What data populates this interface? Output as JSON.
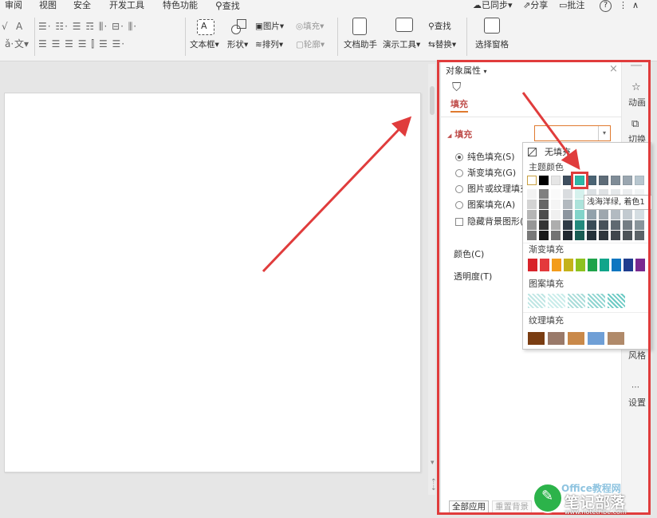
{
  "menu": {
    "review": "审阅",
    "view": "视图",
    "security": "安全",
    "developer": "开发工具",
    "special": "特色功能",
    "search": "查找",
    "synced": "已同步",
    "share": "分享",
    "comment": "批注",
    "help": "?"
  },
  "ribbon": {
    "textbox": "文本框",
    "shape": "形状",
    "picture": "图片",
    "fill": "填充",
    "arrange": "排列",
    "outline": "轮廓",
    "doc_helper": "文档助手",
    "present_tools": "演示工具",
    "find": "查找",
    "replace": "替换",
    "select_pane": "选择窗格",
    "text_a": "A",
    "text_wen": "文"
  },
  "panel": {
    "title": "对象属性",
    "fill_tab": "填充",
    "fill_section": "填充",
    "solid_fill": "纯色填充(S)",
    "gradient_fill": "渐变填充(G)",
    "picture_fill": "图片或纹理填充",
    "pattern_fill": "图案填充(A)",
    "hide_bg": "隐藏背景图形(",
    "color_label": "颜色(C)",
    "transparency_label": "透明度(T)",
    "apply_all": "全部应用",
    "reset_bg": "重置背景"
  },
  "popup": {
    "no_fill": "无填充",
    "theme_colors": "主题颜色",
    "gradient_fill": "渐变填充",
    "pattern_fill": "图案填充",
    "texture_fill": "纹理填充",
    "tooltip": "浅海洋绿, 着色1",
    "theme_row": [
      "#ffffff",
      "#000000",
      "#e6e6e6",
      "#3f4f5f",
      "#2fb8a6",
      "#4a6474",
      "#5e6c78",
      "#7f8c97",
      "#9aa6b0",
      "#b7c6cf"
    ],
    "gradient_colors": [
      "#d8232a",
      "#e4393c",
      "#f39c1b",
      "#c4b21a",
      "#8dc21f",
      "#1ea34a",
      "#10a58a",
      "#0f76c1",
      "#1f3d8f",
      "#7a2a90"
    ],
    "pattern_colors": [
      "#bfe6e4",
      "#c9ecea",
      "#a9dcd9",
      "#8ed4d0",
      "#6ccac4"
    ],
    "texture_colors": [
      "#7a3d12",
      "#9a7a6a",
      "#c9894a",
      "#6f9fd6",
      "#b08a6a"
    ]
  },
  "sidebar": {
    "animation": "动画",
    "switch": "切换",
    "style": "风格",
    "settings": "设置"
  },
  "watermark": {
    "brand": "笔记部落",
    "office": "Office教程网",
    "url": "www.notetribe.com"
  }
}
